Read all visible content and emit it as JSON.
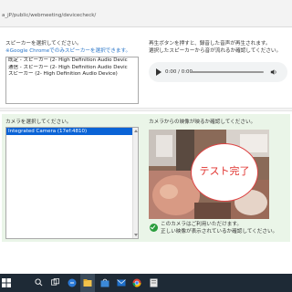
{
  "browser": {
    "url": "a_jP/public/webmeeting/devicecheck/"
  },
  "speaker": {
    "prompt": "スピーカーを選択してください。",
    "note": "※Google Chromeでのみスピーカーを選択できます。",
    "options": [
      "既定 - スピーカー (2- High Definition Audio Devic",
      "通信 - スピーカー (2- High Definition Audio Devic",
      "スピーカー (2- High Definition Audio Device)"
    ]
  },
  "playback": {
    "line1": "再生ボタンを押すと、録音した音声が再生されます。",
    "line2": "選択したスピーカーから音が流れるか確認してください。",
    "time": "0:00 / 0:00",
    "play_icon": "play-icon",
    "volume_icon": "volume-icon"
  },
  "camera": {
    "prompt": "カメラを選択してください。",
    "selected": "Integrated Camera (17ef:4810)",
    "preview_prompt": "カメラからの映像が映るか確認してください。",
    "overlay_text": "テスト完了",
    "ok_line1": "このカメラはご利用いただけます。",
    "ok_line2": "正しい映像が表示されているか確認してください。",
    "ok_icon": "check-circle-icon"
  },
  "taskbar": {
    "items": [
      "start-icon",
      "search-icon",
      "taskview-icon",
      "edge-icon",
      "explorer-icon",
      "store-icon",
      "mail-icon",
      "chrome-icon",
      "app-icon"
    ]
  },
  "colors": {
    "accent_blue": "#0a63d6",
    "note_blue": "#2a76c9",
    "camera_panel": "#eaf5e8",
    "ok_green": "#2b9e3e",
    "test_red": "#e0322e",
    "taskbar": "#1e2a36"
  }
}
